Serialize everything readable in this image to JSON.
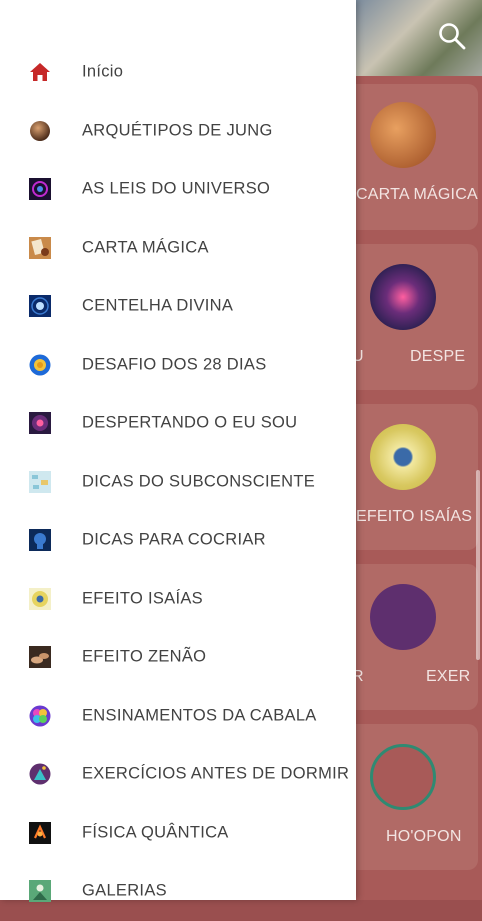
{
  "drawer": {
    "items": [
      {
        "label": "Início",
        "icon": "home-icon"
      },
      {
        "label": "ARQUÉTIPOS DE JUNG",
        "icon": "sphere-icon"
      },
      {
        "label": "AS LEIS DO UNIVERSO",
        "icon": "galaxy-icon"
      },
      {
        "label": "CARTA MÁGICA",
        "icon": "magic-card-icon"
      },
      {
        "label": "CENTELHA DIVINA",
        "icon": "spark-icon"
      },
      {
        "label": "DESAFIO DOS 28 DIAS",
        "icon": "sun-badge-icon"
      },
      {
        "label": "DESPERTANDO O EU SOU",
        "icon": "cosmic-eye-icon"
      },
      {
        "label": "DICAS DO SUBCONSCIENTE",
        "icon": "map-icon"
      },
      {
        "label": "DICAS PARA COCRIAR",
        "icon": "mind-icon"
      },
      {
        "label": "EFEITO ISAÍAS",
        "icon": "sunflower-eye-icon"
      },
      {
        "label": "EFEITO ZENÃO",
        "icon": "hands-icon"
      },
      {
        "label": "ENSINAMENTOS DA CABALA",
        "icon": "flower-of-life-icon"
      },
      {
        "label": "EXERCÍCIOS ANTES DE DORMIR",
        "icon": "night-tent-icon"
      },
      {
        "label": "FÍSICA QUÂNTICA",
        "icon": "quantum-icon"
      },
      {
        "label": "GALERIAS",
        "icon": "gallery-icon"
      }
    ]
  },
  "background": {
    "labels": [
      "CARTA MÁGICA",
      "U",
      "DESPE",
      "EFEITO ISAÍAS",
      "R",
      "EXER",
      "HO'OPON"
    ]
  },
  "colors": {
    "drawer_bg": "#ffffff",
    "text": "#424242",
    "home_icon": "#c62828",
    "backdrop": "#a85a58"
  }
}
